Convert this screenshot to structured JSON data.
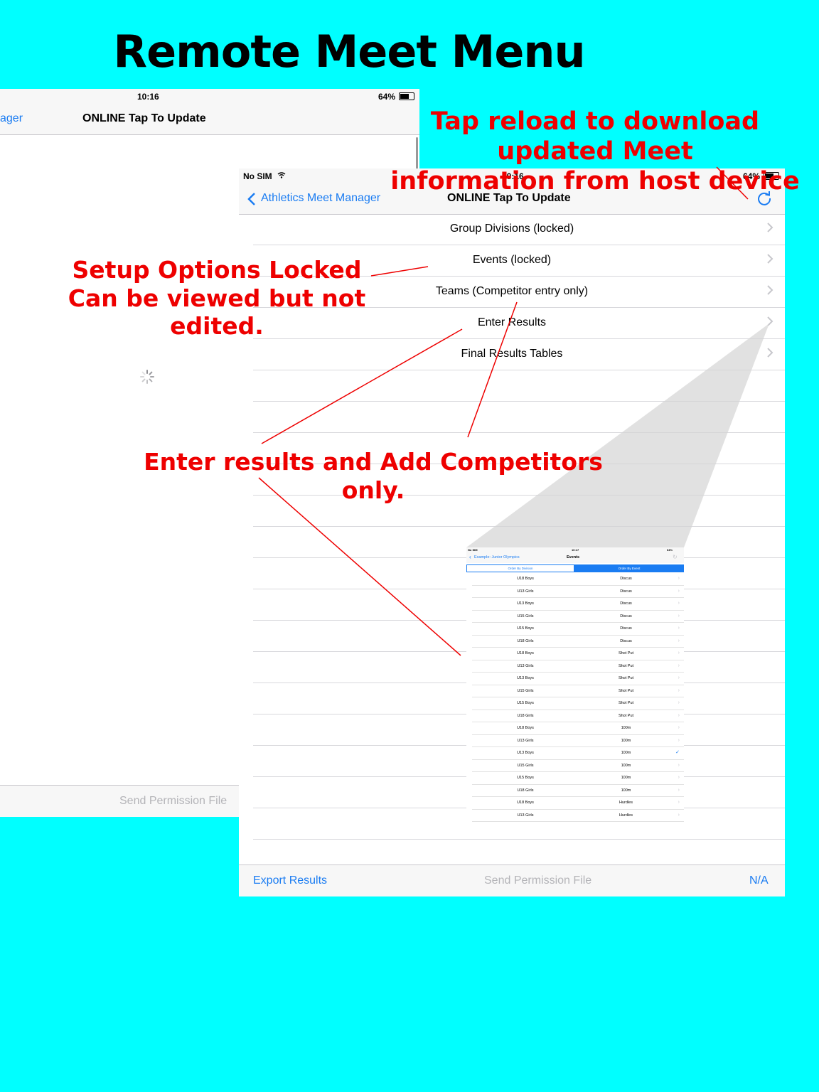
{
  "title": "Remote Meet Menu",
  "annotations": {
    "reload_line1": "Tap reload to download updated Meet",
    "reload_line2": "information from host device",
    "locked_line1": "Setup Options Locked",
    "locked_line2": "Can be viewed but not edited.",
    "enter_results": "Enter results and Add Competitors only."
  },
  "colors": {
    "background": "#00FFFF",
    "annotation": "#EE0000",
    "ios_blue": "#1A7CF2",
    "bar_gray": "#F7F7F7"
  },
  "back_screen": {
    "time": "10:16",
    "battery": "64%",
    "back_label_partial": "ager",
    "nav_title": "ONLINE Tap To Update",
    "refresh_icon": "refresh-icon",
    "spinner_icon": "activity-spinner-icon",
    "bottom_button": "Send Permission File"
  },
  "front_screen": {
    "carrier": "No SIM",
    "time": "10:16",
    "battery": "64%",
    "back_label": "Athletics Meet Manager",
    "nav_title": "ONLINE Tap To Update",
    "refresh_icon": "refresh-icon",
    "menu_items": [
      {
        "label": "Group Divisions (locked)"
      },
      {
        "label": "Events (locked)"
      },
      {
        "label": "Teams (Competitor entry only)"
      },
      {
        "label": "Enter Results"
      },
      {
        "label": "Final Results Tables"
      }
    ],
    "bottom": {
      "export": "Export Results",
      "permission": "Send Permission File",
      "na": "N/A"
    }
  },
  "mini_screen": {
    "carrier": "No SIM",
    "time": "10:17",
    "battery": "64%",
    "back_label": "Example: Junior Olympics",
    "nav_title": "Events",
    "segments": [
      "Order By Division",
      "Order By Event"
    ],
    "selected_segment": 1,
    "rows": [
      {
        "division": "U18 Boys",
        "event": "Discus"
      },
      {
        "division": "U13 Girls",
        "event": "Discus"
      },
      {
        "division": "U13 Boys",
        "event": "Discus"
      },
      {
        "division": "U15 Girls",
        "event": "Discus"
      },
      {
        "division": "U15 Boys",
        "event": "Discus"
      },
      {
        "division": "U18 Girls",
        "event": "Discus"
      },
      {
        "division": "U18 Boys",
        "event": "Shot Put"
      },
      {
        "division": "U13 Girls",
        "event": "Shot Put"
      },
      {
        "division": "U13 Boys",
        "event": "Shot Put"
      },
      {
        "division": "U15 Girls",
        "event": "Shot Put"
      },
      {
        "division": "U15 Boys",
        "event": "Shot Put"
      },
      {
        "division": "U18 Girls",
        "event": "Shot Put"
      },
      {
        "division": "U18 Boys",
        "event": "100m"
      },
      {
        "division": "U13 Girls",
        "event": "100m"
      },
      {
        "division": "U13 Boys",
        "event": "100m",
        "checked": true
      },
      {
        "division": "U15 Girls",
        "event": "100m"
      },
      {
        "division": "U15 Boys",
        "event": "100m"
      },
      {
        "division": "U18 Girls",
        "event": "100m"
      },
      {
        "division": "U18 Boys",
        "event": "Hurdles"
      },
      {
        "division": "U13 Girls",
        "event": "Hurdles"
      }
    ]
  }
}
